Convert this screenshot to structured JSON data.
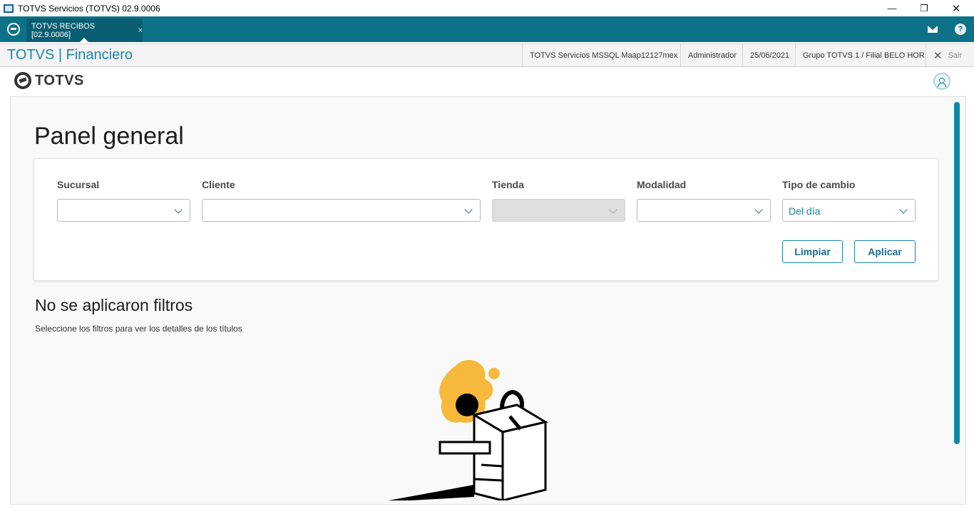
{
  "window": {
    "title": "TOTVS Servicios (TOTVS) 02.9.0006",
    "minimize": "—",
    "restore": "❐",
    "close": "✕"
  },
  "tabbar": {
    "active_tab": "TOTVS RECIBOS [02.9.0006]",
    "tab_close": "×",
    "help": "?"
  },
  "header": {
    "app_title": "TOTVS | Financiero",
    "environment": "TOTVS Servicios MSSQL Maap12127mex",
    "user": "Administrador",
    "date": "25/06/2021",
    "company": "Grupo TOTVS 1 / Filial BELO HOR",
    "exit_label": "Sair"
  },
  "brand": {
    "name": "TOTVS"
  },
  "page": {
    "title": "Panel general",
    "filters": {
      "sucursal": {
        "label": "Sucursal",
        "value": ""
      },
      "cliente": {
        "label": "Cliente",
        "value": ""
      },
      "tienda": {
        "label": "Tienda",
        "value": ""
      },
      "modalidad": {
        "label": "Modalidad",
        "value": ""
      },
      "tipo_cambio": {
        "label": "Tipo de cambio",
        "value": "Del día"
      }
    },
    "buttons": {
      "clear": "Limpiar",
      "apply": "Aplicar"
    },
    "empty_state": {
      "title": "No se aplicaron filtros",
      "subtitle": "Seleccione los filtros para ver los detalles de los títulos"
    }
  },
  "colors": {
    "teal_bar": "#0d7188",
    "accent": "#1a86ad",
    "illustration_yellow": "#f6b93b"
  }
}
